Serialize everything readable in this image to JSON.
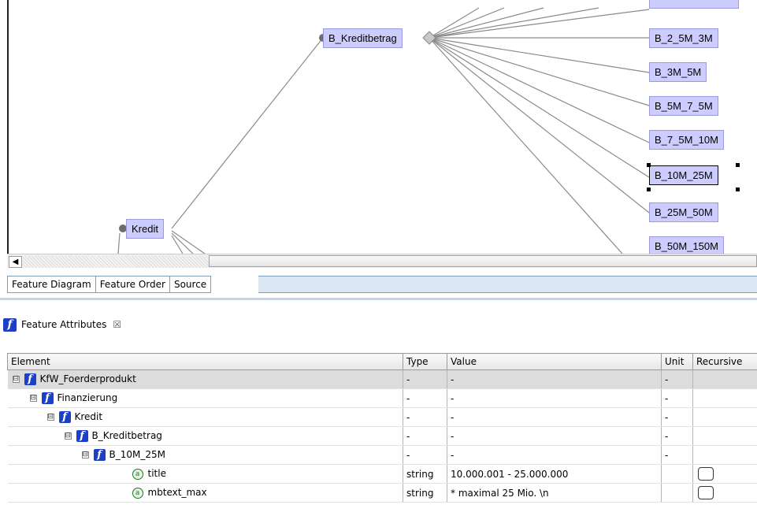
{
  "diagram": {
    "nodes": {
      "kreditbetrag": "B_Kreditbetrag",
      "kredit": "Kredit",
      "b_2_5m_3m": "B_2_5M_3M",
      "b_3m_5m": "B_3M_5M",
      "b_5m_7_5m": "B_5M_7_5M",
      "b_7_5m_10m": "B_7_5M_10M",
      "b_10m_25m": "B_10M_25M",
      "b_25m_50m": "B_25M_50M",
      "b_50m_150m": "B_50M_150M"
    },
    "node_fill": "#ccccff"
  },
  "scrollbar": {
    "left_arrow": "◀"
  },
  "editor_tabs": [
    "Feature Diagram",
    "Feature Order",
    "Source"
  ],
  "view": {
    "title": "Feature Attributes",
    "close": "☒",
    "icon": "f-icon"
  },
  "table": {
    "headers": {
      "element": "Element",
      "type": "Type",
      "value": "Value",
      "unit": "Unit",
      "recursive": "Recursive"
    },
    "rows": [
      {
        "element": "KfW_Foerderprodukt",
        "type": "-",
        "value": "-",
        "unit": "-"
      },
      {
        "element": "Finanzierung",
        "type": "-",
        "value": "-",
        "unit": "-"
      },
      {
        "element": "Kredit",
        "type": "-",
        "value": "-",
        "unit": "-"
      },
      {
        "element": "B_Kreditbetrag",
        "type": "-",
        "value": "-",
        "unit": "-"
      },
      {
        "element": "B_10M_25M",
        "type": "-",
        "value": "-",
        "unit": "-"
      },
      {
        "element": "title",
        "type": "string",
        "value": "10.000.001 - 25.000.000",
        "unit": ""
      },
      {
        "element": "mbtext_max",
        "type": "string",
        "value": "* maximal 25 Mio. \\n",
        "unit": ""
      }
    ],
    "expander_symbol": "⊟",
    "attr_symbol": "a",
    "f_symbol": "f"
  }
}
